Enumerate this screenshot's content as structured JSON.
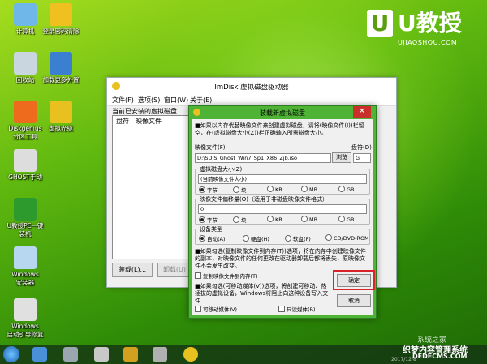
{
  "desktop": {
    "icons": [
      {
        "label": "计算机",
        "icon": "computer-icon",
        "color": "#6fb7e8"
      },
      {
        "label": "登录密码清除",
        "icon": "key-icon",
        "color": "#f0c020"
      },
      {
        "label": "回收站",
        "icon": "recycle-bin-icon",
        "color": "#c9d6e0"
      },
      {
        "label": "加载更多外置",
        "icon": "puzzle-icon",
        "color": "#3a7fd0"
      },
      {
        "label": "Diskgenius\n分区工具",
        "icon": "diskgenius-icon",
        "color": "#ee6a1c"
      },
      {
        "label": "虚拟光驱",
        "icon": "disc-icon",
        "color": "#e8c020"
      },
      {
        "label": "GHOST手动",
        "icon": "ghost-icon",
        "color": "#dddddd"
      },
      {
        "label": "U教授PE一键\n装机",
        "icon": "u-jiaoshou-icon",
        "color": "#2d9a2d"
      },
      {
        "label": "Windows\n安装器",
        "icon": "windows-installer-icon",
        "color": "#b7d7f0"
      },
      {
        "label": "Windows\n启动引导修复",
        "icon": "boot-repair-icon",
        "color": "#e0e0e0"
      }
    ]
  },
  "logo": {
    "mark": "U",
    "name": "U教授",
    "domain": "UJIAOSHOU.COM"
  },
  "main_window": {
    "title": "ImDisk 虚拟磁盘驱动器",
    "menu": [
      "文件(F)",
      "选项(S)",
      "窗口(W)",
      "关于(E)"
    ],
    "section_label": "当前已安装的虚拟磁盘",
    "columns": [
      "盘符",
      "映像文件"
    ],
    "buttons": {
      "mount": "装载(L)...",
      "unmount": "卸载(U)"
    }
  },
  "dialog": {
    "title": "装载新虚拟磁盘",
    "close": "✕",
    "intro": "■如果以内存代替映像文件来创建虚拟磁盘，请将(映像文件(I))栏留空，在(虚拟磁盘大小(Z))栏正确输入所需磁盘大小。",
    "image_file_label": "映像文件(F)",
    "image_file_value": "D:\\SDJS_Ghost_Win7_Sp1_X86_Zjb.iso",
    "browse": "浏览",
    "drive_letter_label": "盘符(D)",
    "drive_letter_value": "G",
    "size_group": "虚拟磁盘大小(Z)",
    "size_value": "(当前映像文件大小)",
    "units": [
      "字节",
      "块",
      "KB",
      "MB",
      "GB"
    ],
    "offset_group": "映像文件偏移量(O)（适用于非磁盘映像文件格式）",
    "offset_value": "0",
    "device_group": "设备类型",
    "device_types": [
      "自动(A)",
      "硬盘(H)",
      "软盘(F)",
      "CD/DVD-ROM"
    ],
    "note1": "■如果勾选(复制映像文件到内存(T))选项，将在内存中创建映像文件的副本，对映像文件的任何更改在驱动器卸载后都将丢失，原映像文件不会发生改变。",
    "copy_to_memory": "复制映像文件到内存(T)",
    "note2": "■如果勾选(可移动媒体(V))选项，将创建可移动、热插拔的虚拟设备，Windows将阻止向这种设备写入文件",
    "removable": "可移动媒体(V)",
    "readonly": "只读媒体(R)",
    "ok": "确定",
    "cancel": "取消"
  },
  "taskbar": {
    "icons": [
      "start-orb-icon",
      "desktop-icon",
      "tools-icon",
      "drive-icon",
      "puzzle-icon",
      "imdisk-icon",
      "disc-icon"
    ]
  },
  "watermark": {
    "line1": "系统之家",
    "line2": "织梦内容管理系统",
    "line3": "DEDECMS.COM",
    "date": "2017/12/8"
  },
  "colors": {
    "accent": "#4fb336",
    "highlight": "#d9232a"
  }
}
